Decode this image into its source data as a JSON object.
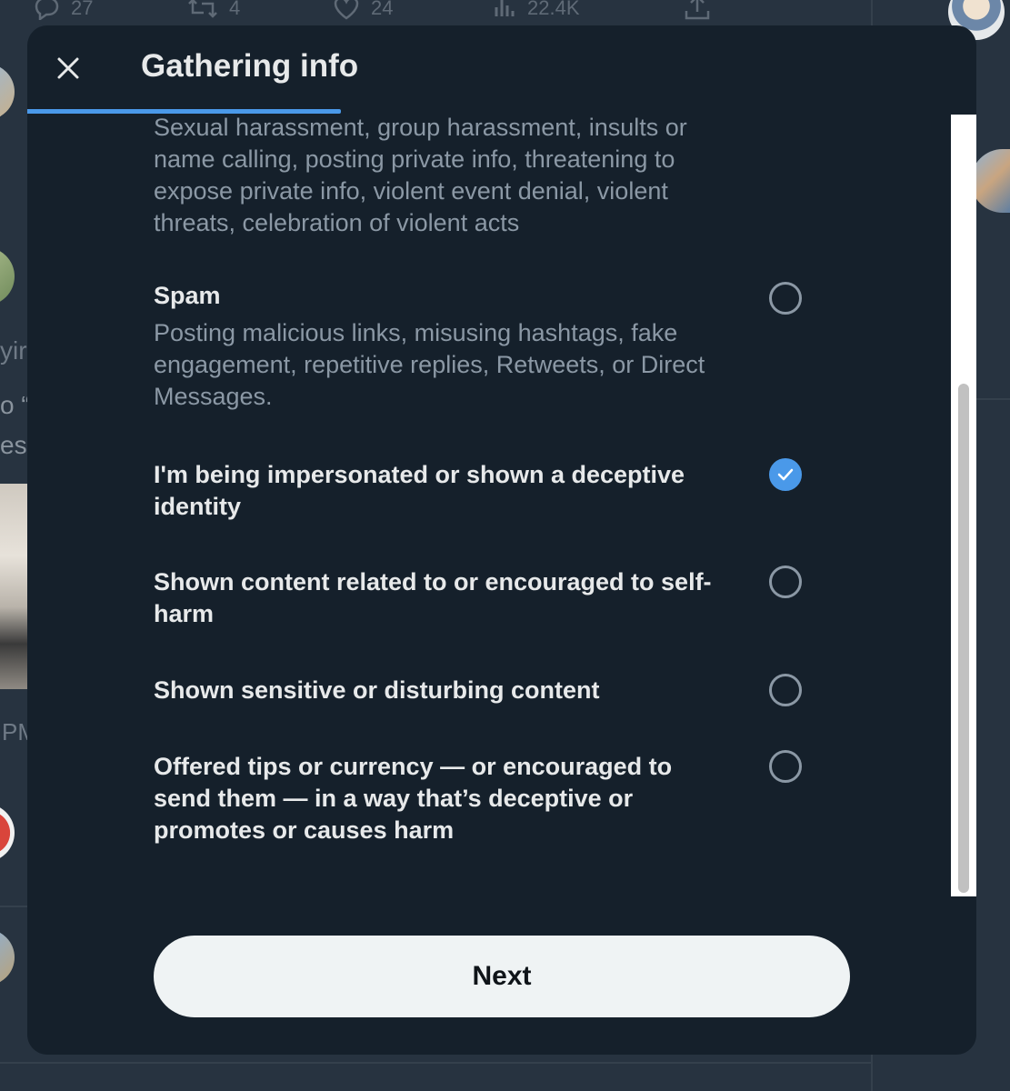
{
  "background": {
    "actions": [
      {
        "icon": "reply-icon",
        "count": "27"
      },
      {
        "icon": "retweet-icon",
        "count": "4"
      },
      {
        "icon": "like-icon",
        "count": "24"
      },
      {
        "icon": "views-icon",
        "count": "22.4K"
      },
      {
        "icon": "share-icon",
        "count": ""
      }
    ],
    "snippets": [
      "yir",
      "o “",
      "es",
      "PM"
    ]
  },
  "modal": {
    "title": "Gathering info",
    "progress_percent": 33,
    "intro_description": "Sexual harassment, group harassment, insults or name calling, posting private info, threatening to expose private info, violent event denial, violent threats, celebration of violent acts",
    "options": [
      {
        "label": "Spam",
        "description": "Posting malicious links, misusing hashtags, fake engagement, repetitive replies, Retweets, or Direct Messages.",
        "selected": false
      },
      {
        "label": "I'm being impersonated or shown a deceptive identity",
        "description": "",
        "selected": true
      },
      {
        "label": "Shown content related to or encouraged to self-harm",
        "description": "",
        "selected": false
      },
      {
        "label": "Shown sensitive or disturbing content",
        "description": "",
        "selected": false
      },
      {
        "label": "Offered tips or currency — or encouraged to send them — in a way that’s deceptive or promotes or causes harm",
        "description": "",
        "selected": false
      }
    ],
    "next_label": "Next"
  },
  "colors": {
    "modal_bg": "#15202b",
    "accent": "#4a99e9",
    "primary_text": "#e7e9ea",
    "secondary_text": "#8b98a5",
    "button_bg": "#eff3f4"
  }
}
